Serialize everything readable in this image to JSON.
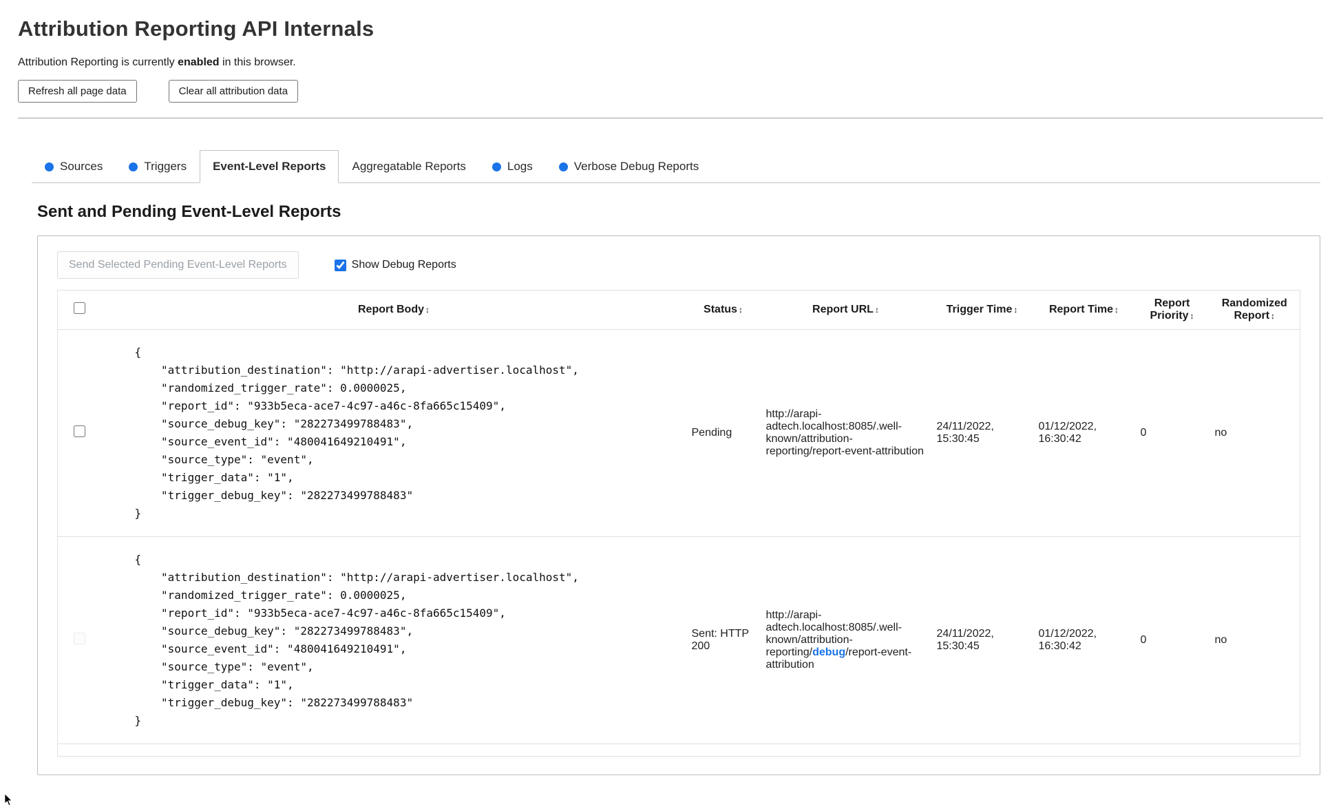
{
  "page": {
    "title": "Attribution Reporting API Internals",
    "status": {
      "prefix": "Attribution Reporting is currently ",
      "bold": "enabled",
      "suffix": " in this browser."
    },
    "buttons": {
      "refresh": "Refresh all page data",
      "clear": "Clear all attribution data"
    }
  },
  "colors": {
    "accent_blue": "#1a73e8",
    "link_blue": "#1a73e8"
  },
  "tabs": [
    {
      "label": "Sources"
    },
    {
      "label": "Triggers"
    },
    {
      "label": "Event-Level Reports"
    },
    {
      "label": "Aggregatable Reports"
    },
    {
      "label": "Logs"
    },
    {
      "label": "Verbose Debug Reports"
    }
  ],
  "section": {
    "heading": "Sent and Pending Event-Level Reports",
    "send_button": "Send Selected Pending Event-Level Reports",
    "show_debug_label": "Show Debug Reports",
    "show_debug_checked": true
  },
  "report_table": {
    "sort_icon": "↕",
    "columns": [
      "Report Body",
      "Status",
      "Report URL",
      "Trigger Time",
      "Report Time",
      "Report Priority",
      "Randomized Report"
    ],
    "rows": [
      {
        "body": "{\n    \"attribution_destination\": \"http://arapi-advertiser.localhost\",\n    \"randomized_trigger_rate\": 0.0000025,\n    \"report_id\": \"933b5eca-ace7-4c97-a46c-8fa665c15409\",\n    \"source_debug_key\": \"282273499788483\",\n    \"source_event_id\": \"480041649210491\",\n    \"source_type\": \"event\",\n    \"trigger_data\": \"1\",\n    \"trigger_debug_key\": \"282273499788483\"\n}",
        "status": "Pending",
        "url_prefix": "http://arapi-adtech.localhost:8085/.well-known/attribution-reporting/report-event-attribution",
        "url_link": "",
        "url_suffix": "",
        "trigger_time": "24/11/2022, 15:30:45",
        "report_time": "01/12/2022, 16:30:42",
        "priority": "0",
        "randomized": "no"
      },
      {
        "body": "{\n    \"attribution_destination\": \"http://arapi-advertiser.localhost\",\n    \"randomized_trigger_rate\": 0.0000025,\n    \"report_id\": \"933b5eca-ace7-4c97-a46c-8fa665c15409\",\n    \"source_debug_key\": \"282273499788483\",\n    \"source_event_id\": \"480041649210491\",\n    \"source_type\": \"event\",\n    \"trigger_data\": \"1\",\n    \"trigger_debug_key\": \"282273499788483\"\n}",
        "status": "Sent: HTTP 200",
        "url_prefix": "http://arapi-adtech.localhost:8085/.well-known/attribution-reporting/",
        "url_link": "debug",
        "url_suffix": "/report-event-attribution",
        "trigger_time": "24/11/2022, 15:30:45",
        "report_time": "01/12/2022, 16:30:42",
        "priority": "0",
        "randomized": "no"
      }
    ]
  }
}
